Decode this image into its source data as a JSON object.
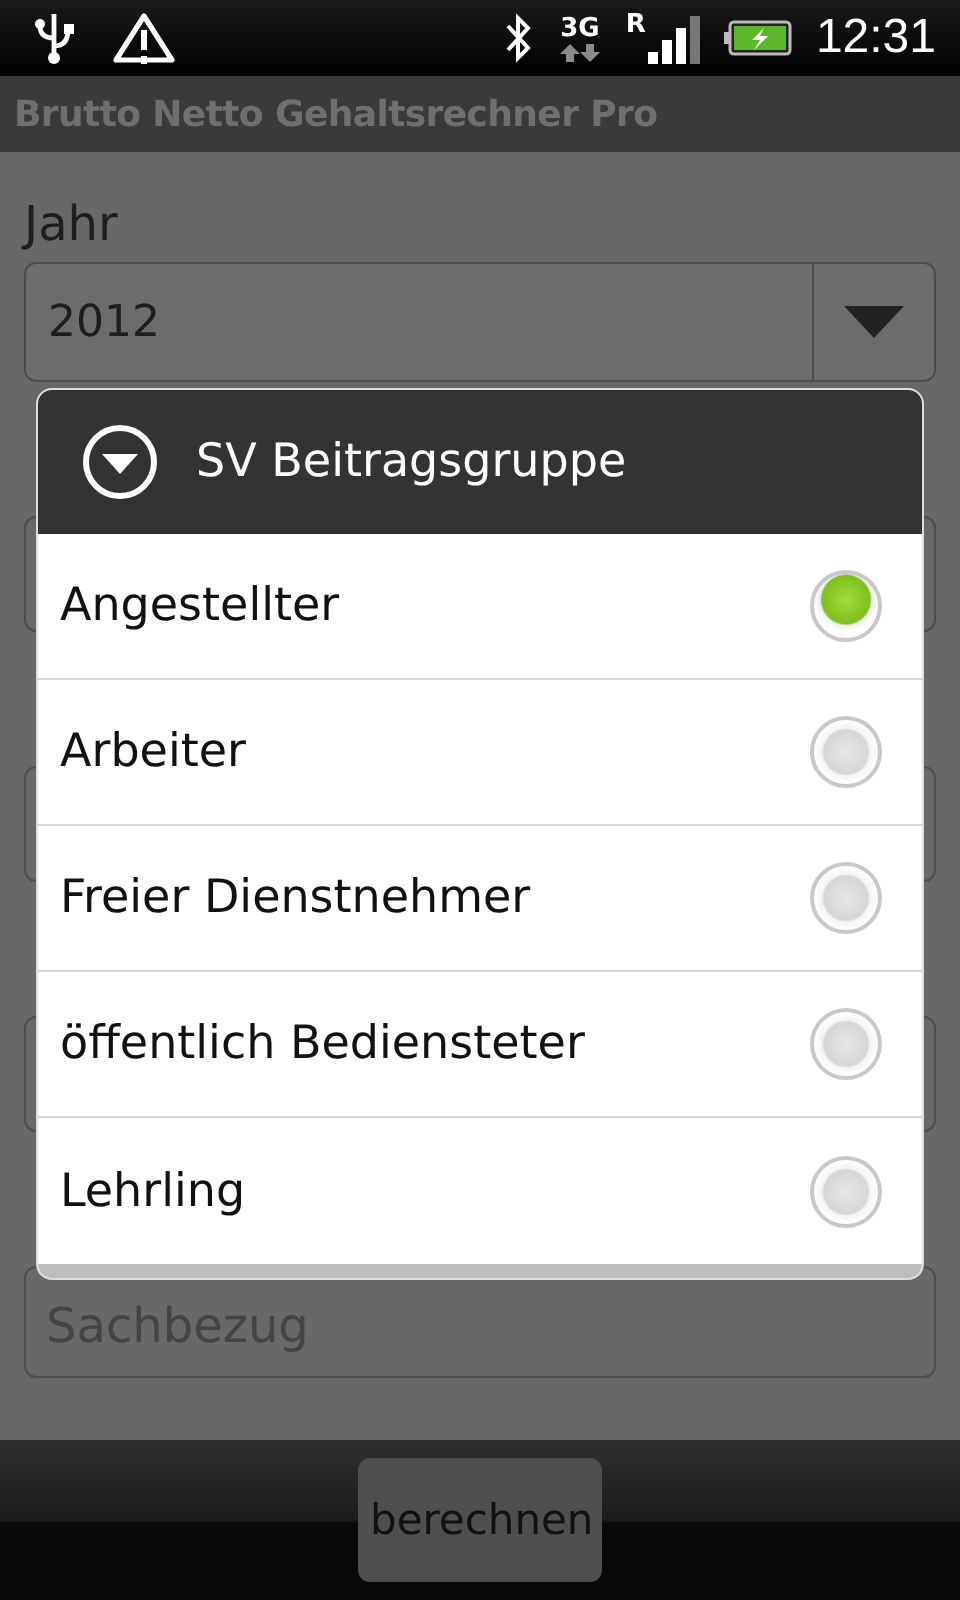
{
  "status_bar": {
    "network": "3G",
    "roaming": "R",
    "time": "12:31"
  },
  "app_title": "Brutto Netto Gehaltsrechner Pro",
  "form": {
    "fields": [
      {
        "kind": "spinner",
        "label": "Jahr",
        "value": "2012"
      },
      {
        "kind": "text"
      },
      {
        "kind": "text"
      },
      {
        "kind": "text"
      },
      {
        "kind": "text",
        "placeholder": "Sachbezug"
      }
    ]
  },
  "dialog": {
    "title": "SV Beitragsgruppe",
    "options": [
      {
        "label": "Angestellter",
        "selected": true
      },
      {
        "label": "Arbeiter",
        "selected": false
      },
      {
        "label": "Freier Dienstnehmer",
        "selected": false
      },
      {
        "label": "öffentlich Bediensteter",
        "selected": false
      },
      {
        "label": "Lehrling",
        "selected": false
      }
    ]
  },
  "buttons": [
    {
      "label": "berechnen"
    }
  ]
}
